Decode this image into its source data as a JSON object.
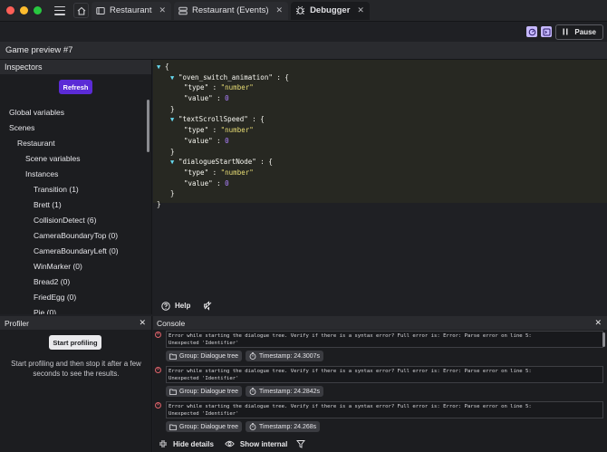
{
  "window": {
    "traffic_colors": [
      "#ff5f57",
      "#febc2e",
      "#28c840"
    ]
  },
  "tabs": [
    {
      "label": "Restaurant",
      "icon": "scene-icon",
      "active": false
    },
    {
      "label": "Restaurant (Events)",
      "icon": "events-icon",
      "active": false
    },
    {
      "label": "Debugger",
      "icon": "bug-icon",
      "active": true
    }
  ],
  "toolbar": {
    "pause_label": "Pause"
  },
  "preview": {
    "title": "Game preview #7"
  },
  "inspectors": {
    "title": "Inspectors",
    "refresh_label": "Refresh",
    "tree": [
      {
        "label": "Global variables",
        "depth": 0
      },
      {
        "label": "Scenes",
        "depth": 0
      },
      {
        "label": "Restaurant",
        "depth": 1
      },
      {
        "label": "Scene variables",
        "depth": 2
      },
      {
        "label": "Instances",
        "depth": 2
      },
      {
        "label": "Transition (1)",
        "depth": 3
      },
      {
        "label": "Brett (1)",
        "depth": 3
      },
      {
        "label": "CollisionDetect (6)",
        "depth": 3
      },
      {
        "label": "CameraBoundaryTop (0)",
        "depth": 3
      },
      {
        "label": "CameraBoundaryLeft (0)",
        "depth": 3
      },
      {
        "label": "WinMarker (0)",
        "depth": 3
      },
      {
        "label": "Bread2 (0)",
        "depth": 3
      },
      {
        "label": "FriedEgg (0)",
        "depth": 3
      },
      {
        "label": "Pie (0)",
        "depth": 3
      }
    ]
  },
  "code": {
    "variables": [
      {
        "name": "\"oven_switch_animation\"",
        "type": "\"number\"",
        "value": "0"
      },
      {
        "name": "\"textScrollSpeed\"",
        "type": "\"number\"",
        "value": "0"
      },
      {
        "name": "\"dialogueStartNode\"",
        "type": "\"number\"",
        "value": "0"
      }
    ],
    "type_key": "\"type\"",
    "value_key": "\"value\""
  },
  "help": {
    "label": "Help"
  },
  "profiler": {
    "title": "Profiler",
    "start_label": "Start profiling",
    "description": "Start profiling and then stop it after a few seconds to see the results."
  },
  "console": {
    "title": "Console",
    "entries": [
      {
        "message": "Error while starting the dialogue tree. Verify if there is a syntax error? Full error is: Error: Parse error on line 5:\nUnexpected 'Identifier'",
        "group": "Group: Dialogue tree",
        "timestamp": "Timestamp: 24.3007s"
      },
      {
        "message": "Error while starting the dialogue tree. Verify if there is a syntax error? Full error is: Error: Parse error on line 5:\nUnexpected 'Identifier'",
        "group": "Group: Dialogue tree",
        "timestamp": "Timestamp: 24.2842s"
      },
      {
        "message": "Error while starting the dialogue tree. Verify if there is a syntax error? Full error is: Error: Parse error on line 5:\nUnexpected 'Identifier'",
        "group": "Group: Dialogue tree",
        "timestamp": "Timestamp: 24.268s"
      }
    ],
    "hide_details_label": "Hide details",
    "show_internal_label": "Show internal"
  },
  "colors": {
    "accent": "#5b2bd6",
    "error": "#e0636b",
    "code_bg": "#272822",
    "code_string": "#e6db74",
    "code_number": "#ae81ff"
  }
}
